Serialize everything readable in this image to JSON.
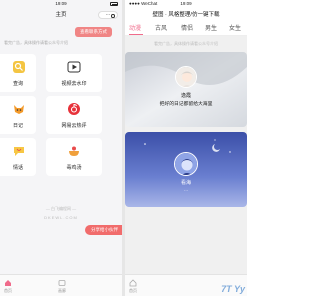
{
  "left": {
    "status": {
      "time": "19:09",
      "battery": "100%"
    },
    "nav": {
      "title": "主页"
    },
    "promo_button": "查看联系方式",
    "tip": "看完广告，具体操作请看公众号介绍",
    "tiles": [
      {
        "label": "查询",
        "icon": "search-icon"
      },
      {
        "label": "视频去水印",
        "icon": "video-play-icon"
      },
      {
        "label": "日记",
        "icon": "fox-icon"
      },
      {
        "label": "网易云热评",
        "icon": "netease-music-icon"
      },
      {
        "label": "情话",
        "icon": "chat-icon"
      },
      {
        "label": "毒鸡汤",
        "icon": "bowl-icon"
      }
    ],
    "footer_brand": "— 白飞编程网 —",
    "footer_domain": "DKEWL.COM",
    "share_button": "分享给小伙伴",
    "tabs": [
      {
        "label": "首页",
        "icon": "home-icon"
      },
      {
        "label": "画廊",
        "icon": "gallery-icon"
      }
    ]
  },
  "right": {
    "status": {
      "carrier": "●●●● WeChat",
      "time": "19:09"
    },
    "nav": {
      "title": "壁图 · 风格整理/仿一键下载"
    },
    "categories": [
      "动漫",
      "古风",
      "情侣",
      "男生",
      "女生"
    ],
    "active_category": "动漫",
    "feed_tip": "看完广告，具体操作请看公众号介绍",
    "cards": [
      {
        "name": "逸霞",
        "desc": "把好的日记都留给大海里",
        "theme": "light"
      },
      {
        "name": "看海",
        "desc": "...",
        "theme": "dark"
      }
    ],
    "tabs": [
      {
        "label": "首页",
        "icon": "home-icon"
      }
    ],
    "watermark": "7T Yy"
  }
}
